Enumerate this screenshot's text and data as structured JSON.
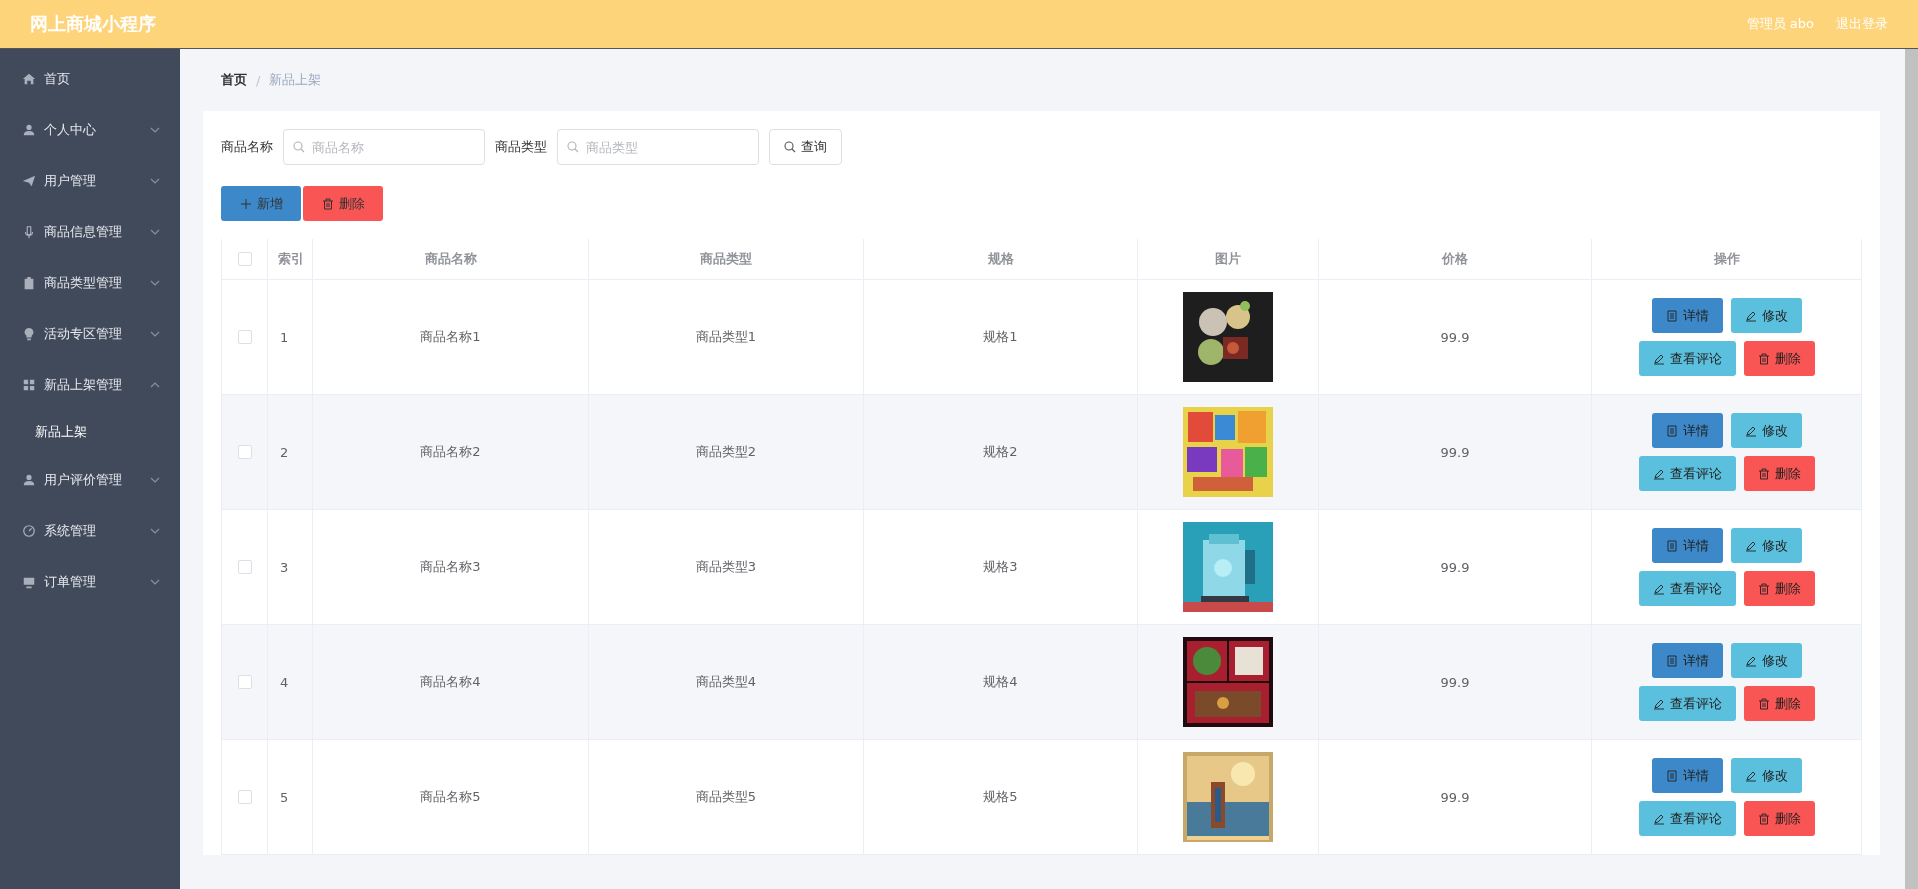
{
  "header": {
    "title": "网上商城小程序",
    "user": "管理员 abo",
    "logout": "退出登录"
  },
  "sidebar": {
    "items": [
      {
        "label": "首页"
      },
      {
        "label": "个人中心",
        "expanded": false
      },
      {
        "label": "用户管理",
        "expanded": false
      },
      {
        "label": "商品信息管理",
        "expanded": false
      },
      {
        "label": "商品类型管理",
        "expanded": false
      },
      {
        "label": "活动专区管理",
        "expanded": false
      },
      {
        "label": "新品上架管理",
        "expanded": true,
        "children": [
          {
            "label": "新品上架",
            "selected": true
          }
        ]
      },
      {
        "label": "用户评价管理",
        "expanded": false
      },
      {
        "label": "系统管理",
        "expanded": false
      },
      {
        "label": "订单管理",
        "expanded": false
      }
    ]
  },
  "breadcrumb": {
    "items": [
      "首页",
      "新品上架"
    ],
    "separator": "/"
  },
  "search": {
    "fields": [
      {
        "label": "商品名称",
        "placeholder": "商品名称"
      },
      {
        "label": "商品类型",
        "placeholder": "商品类型"
      }
    ],
    "button": "查询"
  },
  "toolbar": [
    {
      "label": "新增",
      "kind": "add"
    },
    {
      "label": "删除",
      "kind": "delete"
    }
  ],
  "table": {
    "select_all": {
      "checked": false
    },
    "columns": [
      "索引",
      "商品名称",
      "商品类型",
      "规格",
      "图片",
      "价格",
      "操作"
    ],
    "rows": [
      {
        "checked": false,
        "index": "1",
        "name": "商品名称1",
        "type": "商品类型1",
        "spec": "规格1",
        "price": "99.9",
        "actions": [
          {
            "label": "详情",
            "kind": "detail"
          },
          {
            "label": "修改",
            "kind": "edit"
          },
          {
            "label": "查看评论",
            "kind": "comment"
          },
          {
            "label": "删除",
            "kind": "delete"
          }
        ]
      },
      {
        "checked": false,
        "index": "2",
        "name": "商品名称2",
        "type": "商品类型2",
        "spec": "规格2",
        "price": "99.9",
        "actions": [
          {
            "label": "详情",
            "kind": "detail"
          },
          {
            "label": "修改",
            "kind": "edit"
          },
          {
            "label": "查看评论",
            "kind": "comment"
          },
          {
            "label": "删除",
            "kind": "delete"
          }
        ]
      },
      {
        "checked": false,
        "index": "3",
        "name": "商品名称3",
        "type": "商品类型3",
        "spec": "规格3",
        "price": "99.9",
        "actions": [
          {
            "label": "详情",
            "kind": "detail"
          },
          {
            "label": "修改",
            "kind": "edit"
          },
          {
            "label": "查看评论",
            "kind": "comment"
          },
          {
            "label": "删除",
            "kind": "delete"
          }
        ]
      },
      {
        "checked": false,
        "index": "4",
        "name": "商品名称4",
        "type": "商品类型4",
        "spec": "规格4",
        "price": "99.9",
        "actions": [
          {
            "label": "详情",
            "kind": "detail"
          },
          {
            "label": "修改",
            "kind": "edit"
          },
          {
            "label": "查看评论",
            "kind": "comment"
          },
          {
            "label": "删除",
            "kind": "delete"
          }
        ]
      },
      {
        "checked": false,
        "index": "5",
        "name": "商品名称5",
        "type": "商品类型5",
        "spec": "规格5",
        "price": "99.9",
        "actions": [
          {
            "label": "详情",
            "kind": "detail"
          },
          {
            "label": "修改",
            "kind": "edit"
          },
          {
            "label": "查看评论",
            "kind": "comment"
          },
          {
            "label": "删除",
            "kind": "delete"
          }
        ]
      }
    ]
  }
}
